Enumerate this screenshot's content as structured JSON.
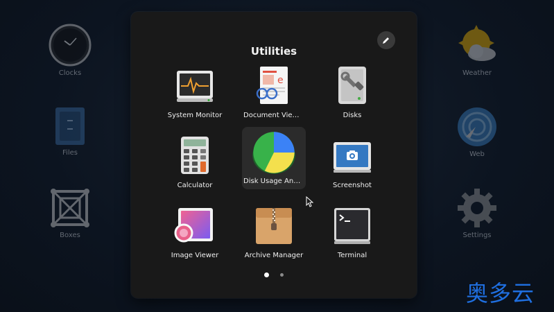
{
  "background": {
    "apps_left": [
      {
        "label": "Clocks",
        "icon": "clock-icon"
      },
      {
        "label": "Files",
        "icon": "files-icon"
      },
      {
        "label": "Boxes",
        "icon": "boxes-icon"
      }
    ],
    "apps_right": [
      {
        "label": "Weather",
        "icon": "weather-icon"
      },
      {
        "label": "Web",
        "icon": "web-icon"
      },
      {
        "label": "Settings",
        "icon": "gear-icon"
      }
    ]
  },
  "folder": {
    "title": "Utilities",
    "edit_icon": "pencil-icon",
    "apps": [
      {
        "label": "System Monitor",
        "icon": "system-monitor-icon"
      },
      {
        "label": "Document Viewer",
        "icon": "document-viewer-icon"
      },
      {
        "label": "Disks",
        "icon": "disks-icon"
      },
      {
        "label": "Calculator",
        "icon": "calculator-icon"
      },
      {
        "label": "Disk Usage Anal...",
        "icon": "disk-usage-analyzer-icon"
      },
      {
        "label": "Screenshot",
        "icon": "screenshot-icon"
      },
      {
        "label": "Image Viewer",
        "icon": "image-viewer-icon"
      },
      {
        "label": "Archive Manager",
        "icon": "archive-manager-icon"
      },
      {
        "label": "Terminal",
        "icon": "terminal-icon"
      }
    ],
    "pages": {
      "current": 1,
      "total": 2
    }
  },
  "watermark": "奥多云",
  "colors": {
    "folder_bg": "#191919",
    "watermark": "#1f6fe0",
    "accent_blue": "#3b82f6"
  }
}
